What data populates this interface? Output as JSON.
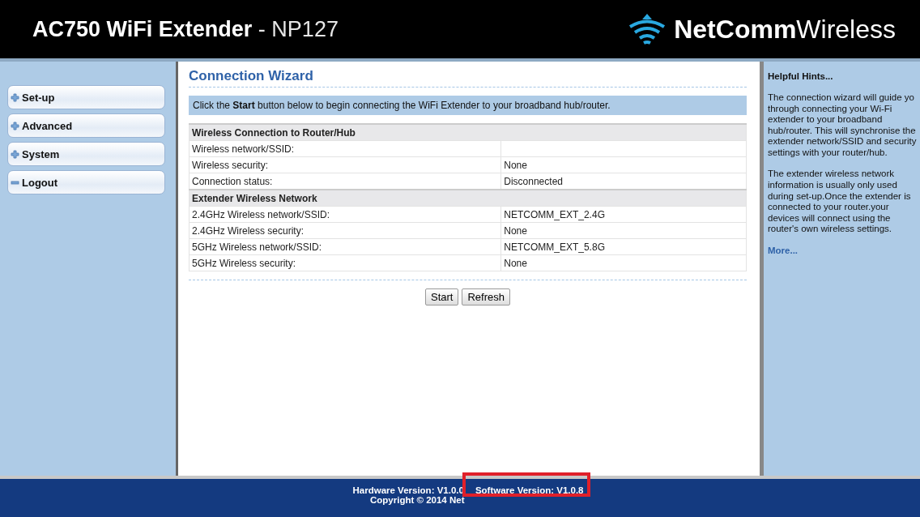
{
  "header": {
    "product": "AC750 WiFi Extender",
    "model": "- NP127",
    "brand_bold": "NetComm",
    "brand_light": "Wireless"
  },
  "sidebar": {
    "items": [
      {
        "label": "Set-up",
        "kind": "plus"
      },
      {
        "label": "Advanced",
        "kind": "plus"
      },
      {
        "label": "System",
        "kind": "plus"
      },
      {
        "label": "Logout",
        "kind": "minus"
      }
    ]
  },
  "main": {
    "title": "Connection Wizard",
    "intro": "Click the **Start** button below to begin connecting the WiFi Extender to your broadband hub/router.",
    "sections": [
      {
        "heading": "Wireless Connection to Router/Hub",
        "rows": [
          {
            "label": "Wireless network/SSID:",
            "value": ""
          },
          {
            "label": "Wireless security:",
            "value": "None"
          },
          {
            "label": "Connection status:",
            "value": "Disconnected"
          }
        ]
      },
      {
        "heading": "Extender Wireless Network",
        "rows": [
          {
            "label": "2.4GHz Wireless network/SSID:",
            "value": "NETCOMM_EXT_2.4G"
          },
          {
            "label": "2.4GHz Wireless security:",
            "value": "None"
          },
          {
            "label": "5GHz Wireless network/SSID:",
            "value": "NETCOMM_EXT_5.8G"
          },
          {
            "label": "5GHz Wireless security:",
            "value": "None"
          }
        ]
      }
    ],
    "buttons": [
      "Start",
      "Refresh"
    ]
  },
  "hints": {
    "title": "Helpful Hints...",
    "paragraphs": [
      "The connection wizard will guide yo\nthrough connecting your Wi-Fi\nextender to your broadband\nhub/router. This will synchronise the\nextender network/SSID and security\nsettings with your router/hub.",
      "The extender wireless network\ninformation is usually only used\nduring set-up.Once the extender is\nconnected to your router.your\ndevices will connect using the\nrouter's own wireless settings."
    ],
    "more": "More..."
  },
  "footer": {
    "hardware": "Hardware Version: V1.0.0",
    "software": "Software Version: V1.0.8",
    "copyright": "Copyright © 2014 Net",
    "highlight": true
  }
}
